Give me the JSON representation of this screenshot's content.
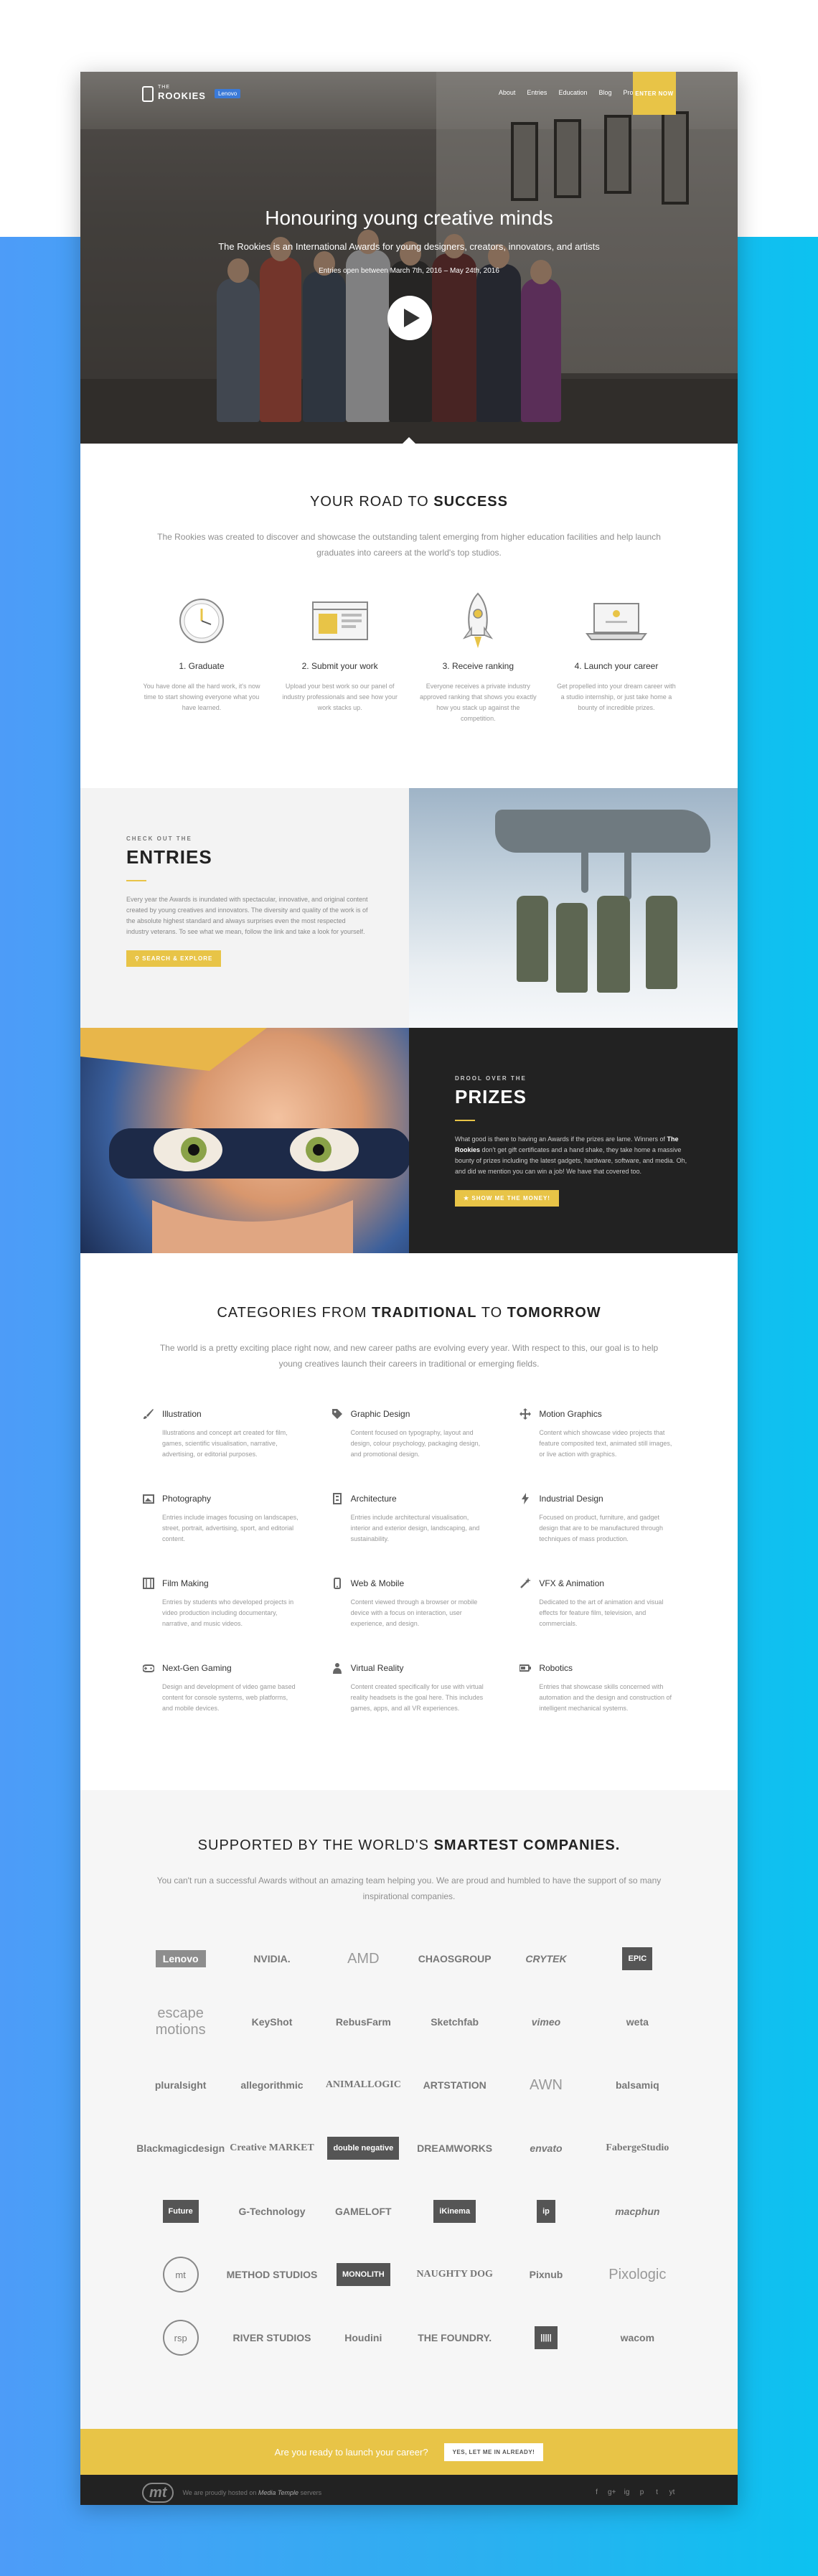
{
  "nav": {
    "logo_small": "THE",
    "logo_main": "ROOKIES",
    "badge": "Lenovo",
    "links": [
      "About",
      "Entries",
      "Education",
      "Blog",
      "Profile"
    ],
    "enter": "ENTER NOW"
  },
  "hero": {
    "title": "Honouring young creative minds",
    "subtitle": "The Rookies is an International Awards for young designers, creators, innovators, and artists",
    "dates": "Entries open between March 7th, 2016 – May 24th, 2016"
  },
  "road": {
    "title_a": "YOUR ROAD TO ",
    "title_b": "SUCCESS",
    "intro": "The Rookies was created to discover and showcase the outstanding talent emerging from higher education facilities and help launch graduates into careers at the world's top studios.",
    "steps": [
      {
        "title": "1. Graduate",
        "desc": "You have done all the hard work, it's now time to start showing everyone what you have learned."
      },
      {
        "title": "2. Submit your work",
        "desc": "Upload your best work so our panel of industry professionals and see how your work stacks up."
      },
      {
        "title": "3. Receive ranking",
        "desc": "Everyone receives a private industry approved ranking that shows you exactly how you stack up against the competition."
      },
      {
        "title": "4. Launch your career",
        "desc": "Get propelled into your dream career with a studio internship, or just take home a bounty of incredible prizes."
      }
    ]
  },
  "entries": {
    "kicker": "CHECK OUT THE",
    "title": "ENTRIES",
    "body": "Every year the Awards is inundated with spectacular, innovative, and original content created by young creatives and innovators. The diversity and quality of the work is of the absolute highest standard and always surprises even the most respected industry veterans. To see what we mean, follow the link and take a look for yourself.",
    "button": "SEARCH & EXPLORE"
  },
  "prizes": {
    "kicker": "DROOL OVER THE",
    "title": "PRIZES",
    "body_a": "What good is there to having an Awards if the prizes are lame. Winners of ",
    "body_bold": "The Rookies",
    "body_b": " don't get gift certificates and a hand shake, they take home a massive bounty of prizes including the latest gadgets, hardware, software, and media. Oh, and did we mention you can win a job! We have that covered too.",
    "button": "SHOW ME THE MONEY!"
  },
  "categories": {
    "title_a": "CATEGORIES FROM ",
    "title_b": "TRADITIONAL",
    "title_c": " TO ",
    "title_d": "TOMORROW",
    "intro": "The world is a pretty exciting place right now, and new career paths are evolving every year. With respect to this, our goal is to help young creatives launch their careers in traditional or emerging fields.",
    "items": [
      {
        "icon": "brush-icon",
        "title": "Illustration",
        "desc": "Illustrations and concept art created for film, games, scientific visualisation, narrative, advertising, or editorial purposes."
      },
      {
        "icon": "tag-icon",
        "title": "Graphic Design",
        "desc": "Content focused on typography, layout and design, colour psychology, packaging design, and promotional design."
      },
      {
        "icon": "move-icon",
        "title": "Motion Graphics",
        "desc": "Content which showcase video projects that feature composited text, animated still images, or live action with graphics."
      },
      {
        "icon": "photo-icon",
        "title": "Photography",
        "desc": "Entries include images focusing on landscapes, street, portrait, advertising, sport, and editorial content."
      },
      {
        "icon": "building-icon",
        "title": "Architecture",
        "desc": "Entries include architectural visualisation, interior and exterior design, landscaping, and sustainability."
      },
      {
        "icon": "bolt-icon",
        "title": "Industrial Design",
        "desc": "Focused on product, furniture, and gadget design that are to be manufactured through techniques of mass production."
      },
      {
        "icon": "film-icon",
        "title": "Film Making",
        "desc": "Entries by students who developed projects in video production including documentary, narrative, and music videos."
      },
      {
        "icon": "mobile-icon",
        "title": "Web & Mobile",
        "desc": "Content viewed through a browser or mobile device with a focus on interaction, user experience, and design."
      },
      {
        "icon": "magic-icon",
        "title": "VFX & Animation",
        "desc": "Dedicated to the art of animation and visual effects for feature film, television, and commercials."
      },
      {
        "icon": "gamepad-icon",
        "title": "Next-Gen Gaming",
        "desc": "Design and development of video game based content for console systems, web platforms, and mobile devices."
      },
      {
        "icon": "user-icon",
        "title": "Virtual Reality",
        "desc": "Content created specifically for use with virtual reality headsets is the goal here. This includes games, apps, and all VR experiences."
      },
      {
        "icon": "battery-icon",
        "title": "Robotics",
        "desc": "Entries that showcase skills concerned with automation and the design and construction of intelligent mechanical systems."
      }
    ]
  },
  "sponsors": {
    "title_a": "SUPPORTED BY THE WORLD'S ",
    "title_b": "SMARTEST COMPANIES.",
    "intro": "You can't run a successful Awards without an amazing team helping you. We are proud and humbled to have the support of so many inspirational companies.",
    "logos": [
      {
        "name": "Lenovo",
        "style": "boxed"
      },
      {
        "name": "NVIDIA.",
        "style": ""
      },
      {
        "name": "AMD",
        "style": "light"
      },
      {
        "name": "CHAOSGROUP",
        "style": ""
      },
      {
        "name": "CRYTEK",
        "style": "italic"
      },
      {
        "name": "EPIC",
        "style": "dark"
      },
      {
        "name": "escape motions",
        "style": "light"
      },
      {
        "name": "KeyShot",
        "style": ""
      },
      {
        "name": "RebusFarm",
        "style": ""
      },
      {
        "name": "Sketchfab",
        "style": ""
      },
      {
        "name": "vimeo",
        "style": "italic"
      },
      {
        "name": "weta",
        "style": ""
      },
      {
        "name": "pluralsight",
        "style": ""
      },
      {
        "name": "allegorithmic",
        "style": ""
      },
      {
        "name": "ANIMALLOGIC",
        "style": "serif"
      },
      {
        "name": "ARTSTATION",
        "style": ""
      },
      {
        "name": "AWN",
        "style": "light"
      },
      {
        "name": "balsamiq",
        "style": ""
      },
      {
        "name": "Blackmagicdesign",
        "style": ""
      },
      {
        "name": "Creative MARKET",
        "style": "serif"
      },
      {
        "name": "double negative",
        "style": "dark"
      },
      {
        "name": "DREAMWORKS",
        "style": ""
      },
      {
        "name": "envato",
        "style": "italic"
      },
      {
        "name": "FabergeStudio",
        "style": "serif"
      },
      {
        "name": "Future",
        "style": "dark"
      },
      {
        "name": "G-Technology",
        "style": ""
      },
      {
        "name": "GAMELOFT",
        "style": ""
      },
      {
        "name": "iKinema",
        "style": "dark"
      },
      {
        "name": "ip",
        "style": "dark"
      },
      {
        "name": "macphun",
        "style": "italic"
      },
      {
        "name": "mt",
        "style": "circle"
      },
      {
        "name": "METHOD STUDIOS",
        "style": ""
      },
      {
        "name": "MONOLITH",
        "style": "dark"
      },
      {
        "name": "NAUGHTY DOG",
        "style": "serif"
      },
      {
        "name": "Pixnub",
        "style": ""
      },
      {
        "name": "Pixologic",
        "style": "light"
      },
      {
        "name": "rsp",
        "style": "circle"
      },
      {
        "name": "RIVER STUDIOS",
        "style": ""
      },
      {
        "name": "Houdini",
        "style": ""
      },
      {
        "name": "THE FOUNDRY.",
        "style": ""
      },
      {
        "name": "|||||",
        "style": "dark"
      },
      {
        "name": "wacom",
        "style": ""
      }
    ]
  },
  "cta": {
    "text": "Are you ready to launch your career?",
    "button": "YES, LET ME IN ALREADY!"
  },
  "footer": {
    "logo": "mt",
    "text_a": "We are proudly hosted on ",
    "link": "Media Temple",
    "text_b": " servers",
    "social": [
      "f",
      "g+",
      "ig",
      "p",
      "t",
      "yt"
    ]
  },
  "colors": {
    "accent": "#e8c447",
    "background_blue": "#2bb0f0",
    "dark": "#222222"
  }
}
